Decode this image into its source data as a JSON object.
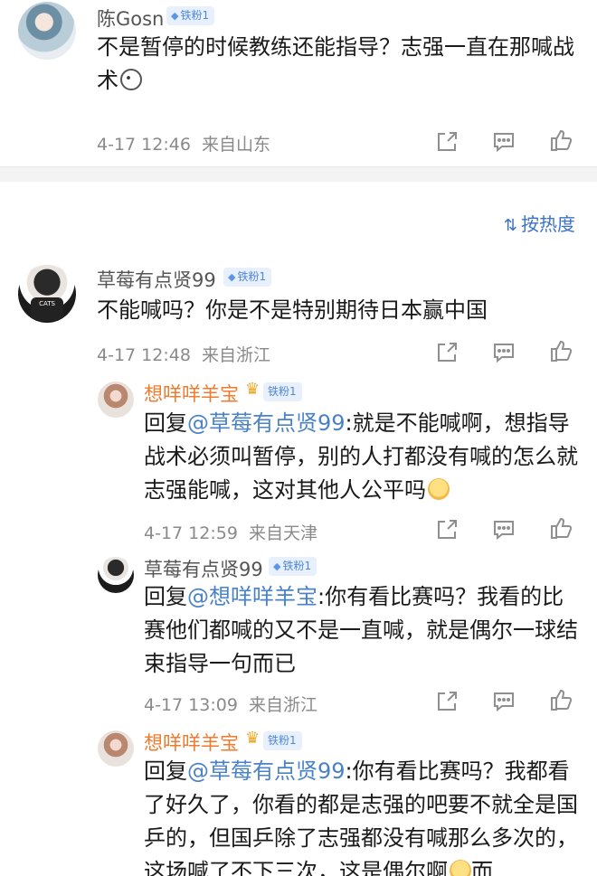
{
  "comments": [
    {
      "user": "陈Gosn",
      "badge": "铁粉1",
      "text": "不是暂停的时候教练还能指导？志强一直在那喊战术",
      "time": "4-17 12:46",
      "location": "来自山东"
    },
    {
      "user": "草莓有点贤99",
      "badge": "铁粉1",
      "text": "不能喊吗？你是不是特别期待日本赢中国",
      "time": "4-17 12:48",
      "location": "来自浙江",
      "avatar_shirt": "CATS"
    },
    {
      "user": "想咩咩羊宝",
      "badge": "铁粉1",
      "reply_prefix": "回复",
      "mention": "@草莓有点贤99",
      "text": ":就是不能喊啊，想指导战术必须叫暂停，别的人打都没有喊的怎么就志强能喊，这对其他人公平吗",
      "time": "4-17 12:59",
      "location": "来自天津"
    },
    {
      "user": "草莓有点贤99",
      "badge": "铁粉1",
      "reply_prefix": "回复",
      "mention": "@想咩咩羊宝",
      "text": ":你有看比赛吗？我看的比赛他们都喊的又不是一直喊，就是偶尔一球结束指导一句而已",
      "time": "4-17 13:09",
      "location": "来自浙江",
      "avatar_shirt": "CATS"
    },
    {
      "user": "想咩咩羊宝",
      "badge": "铁粉1",
      "reply_prefix": "回复",
      "mention": "@草莓有点贤99",
      "text": ":你有看比赛吗？我都看了好久了，你看的都是志强的吧要不就全是国乒的，但国乒除了志强都没有喊那么多次的，这场喊了不下三次，这是偶尔啊",
      "text_tail": "而"
    }
  ],
  "sort": {
    "label": "按热度",
    "icon": "sort-icon"
  },
  "icons": {
    "share": "share-icon",
    "comment": "comment-icon",
    "like": "like-icon"
  },
  "colors": {
    "mention": "#4a82c7",
    "orange_name": "#f07b2d",
    "badge_bg": "#e7f0fc"
  }
}
